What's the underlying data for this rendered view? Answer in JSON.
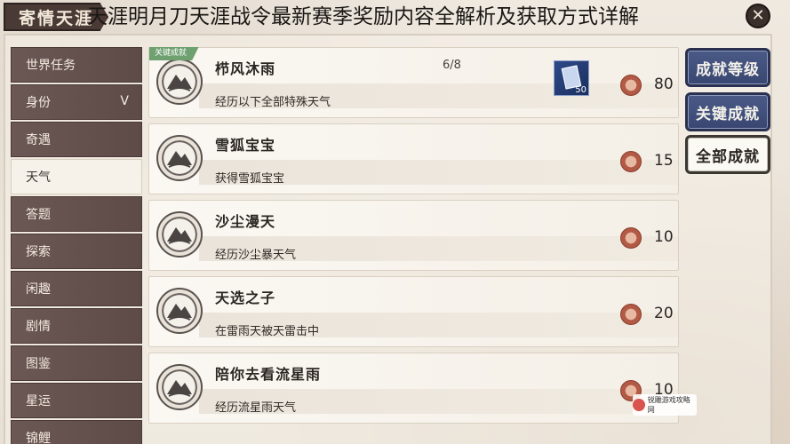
{
  "header": {
    "badge": "寄情天涯",
    "overlay_title": "天涯明月刀天涯战令最新赛季奖励内容全解析及获取方式详解",
    "close_symbol": "✕"
  },
  "sidebar": {
    "items": [
      {
        "label": "世界任务",
        "active": false
      },
      {
        "label": "身份",
        "active": false,
        "chevron": "ᐯ"
      },
      {
        "label": "奇遇",
        "active": false
      },
      {
        "label": "天气",
        "active": true
      },
      {
        "label": "答题",
        "active": false
      },
      {
        "label": "探索",
        "active": false
      },
      {
        "label": "闲趣",
        "active": false
      },
      {
        "label": "剧情",
        "active": false
      },
      {
        "label": "图鉴",
        "active": false
      },
      {
        "label": "星运",
        "active": false
      },
      {
        "label": "锦鲤",
        "active": false
      }
    ]
  },
  "achievements": [
    {
      "tag": "关键成就",
      "name": "栉风沐雨",
      "progress": "6/8",
      "desc": "经历以下全部特殊天气",
      "reward_count": "50",
      "points": "80"
    },
    {
      "name": "雪狐宝宝",
      "desc": "获得雪狐宝宝",
      "points": "15"
    },
    {
      "name": "沙尘漫天",
      "desc": "经历沙尘暴天气",
      "points": "10"
    },
    {
      "name": "天选之子",
      "desc": "在雷雨天被天雷击中",
      "points": "20"
    },
    {
      "name": "陪你去看流星雨",
      "desc": "经历流星雨天气",
      "points": "10"
    }
  ],
  "right_buttons": [
    {
      "label": "成就等级",
      "style": "dark"
    },
    {
      "label": "关键成就",
      "style": "dark"
    },
    {
      "label": "全部成就",
      "style": "light"
    }
  ],
  "watermark": {
    "line1": "锐雕游戏攻略网"
  },
  "colors": {
    "sidebar": "#5e4b47",
    "accent_button": "#394672",
    "key_tag": "#6fa070"
  },
  "icons": {
    "emblem": "mountain-emblem-icon",
    "points": "achievement-points-icon",
    "reward": "card-reward-icon"
  }
}
